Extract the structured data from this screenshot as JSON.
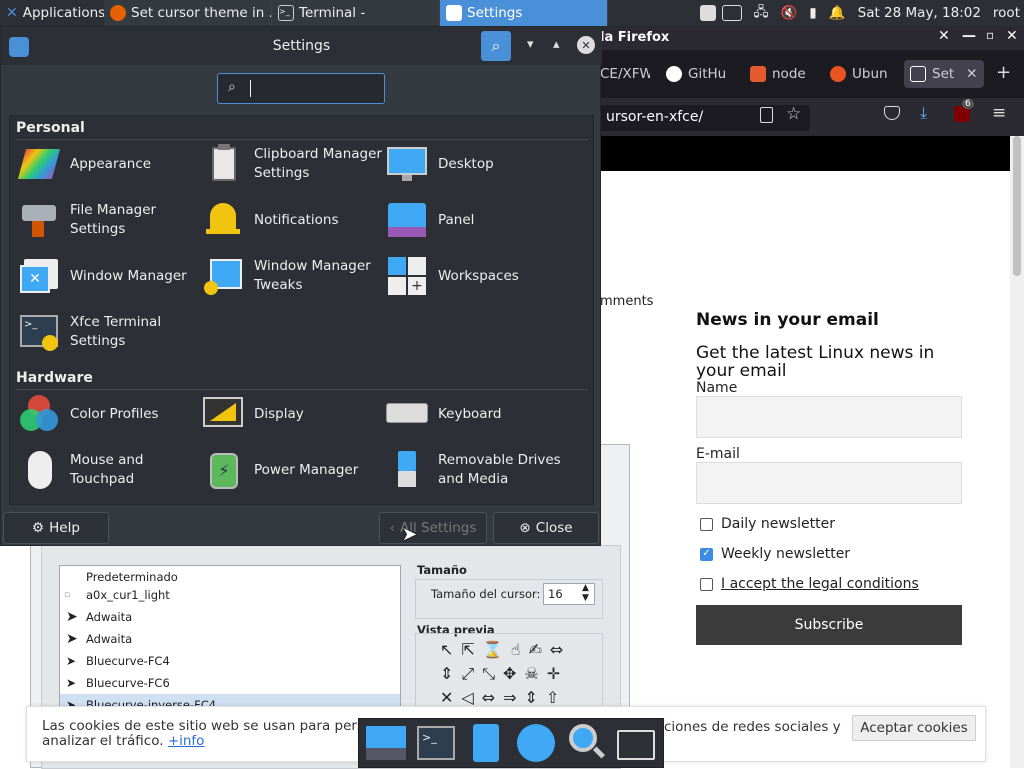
{
  "panel": {
    "applications_label": "Applications",
    "tasks": [
      {
        "label": "Set cursor theme in ..."
      },
      {
        "label": "Terminal -"
      },
      {
        "label": "Settings"
      }
    ],
    "clock": "Sat 28 May, 18:02",
    "user": "root"
  },
  "firefox": {
    "title_partial": "la Firefox",
    "tabs": [
      "CE/XFW",
      "GitHu",
      "node",
      "Ubun",
      "Set"
    ],
    "url_partial": "ursor-en-xfce/",
    "badge_count": "6",
    "comments_partial": "mments",
    "news": {
      "heading": "News in your email",
      "subheading": "Get the latest Linux news in your email",
      "name_label": "Name",
      "email_label": "E-mail",
      "options": [
        {
          "label": "Daily newsletter",
          "checked": false
        },
        {
          "label": "Weekly newsletter",
          "checked": true
        },
        {
          "label": "I accept the legal conditions",
          "checked": false
        }
      ],
      "subscribe_label": "Subscribe"
    }
  },
  "appearance": {
    "cursor_list": [
      "Predeterminado",
      "a0x_cur1_light",
      "Adwaita",
      "Adwaita",
      "Bluecurve-FC4",
      "Bluecurve-FC6",
      "Bluecurve-inverse-FC4"
    ],
    "size_section": "Tamaño",
    "size_label": "Tamaño del cursor:",
    "size_value": "16",
    "preview_section": "Vista previa"
  },
  "settings": {
    "title": "Settings",
    "search_value": "",
    "sections": [
      {
        "title": "Personal",
        "items": [
          {
            "label": "Appearance",
            "icon": "appearance-icon"
          },
          {
            "label": "Clipboard Manager Settings",
            "icon": "clipboard-icon"
          },
          {
            "label": "Desktop",
            "icon": "desktop-icon"
          },
          {
            "label": "File Manager Settings",
            "icon": "file-manager-icon"
          },
          {
            "label": "Notifications",
            "icon": "bell-icon"
          },
          {
            "label": "Panel",
            "icon": "panel-icon"
          },
          {
            "label": "Window Manager",
            "icon": "window-manager-icon"
          },
          {
            "label": "Window Manager Tweaks",
            "icon": "window-tweaks-icon"
          },
          {
            "label": "Workspaces",
            "icon": "workspaces-icon"
          },
          {
            "label": "Xfce Terminal Settings",
            "icon": "terminal-settings-icon"
          }
        ]
      },
      {
        "title": "Hardware",
        "items": [
          {
            "label": "Color Profiles",
            "icon": "color-profiles-icon"
          },
          {
            "label": "Display",
            "icon": "display-icon"
          },
          {
            "label": "Keyboard",
            "icon": "keyboard-icon"
          },
          {
            "label": "Mouse and Touchpad",
            "icon": "mouse-icon"
          },
          {
            "label": "Power Manager",
            "icon": "battery-icon"
          },
          {
            "label": "Removable Drives and Media",
            "icon": "usb-icon"
          }
        ]
      }
    ],
    "help_label": "Help",
    "all_settings_label": "All Settings",
    "close_label": "Close"
  },
  "cookie": {
    "text_start": "Las cookies de este sitio web se usan para perso",
    "text_end": "ciones de redes sociales y",
    "text_line2": "analizar el tráfico.",
    "more_link": "+info",
    "accept_label": "Aceptar cookies"
  },
  "colors": {
    "accent": "#4a90d9",
    "panel_bg": "#2c3036",
    "window_bg": "#353a41"
  }
}
